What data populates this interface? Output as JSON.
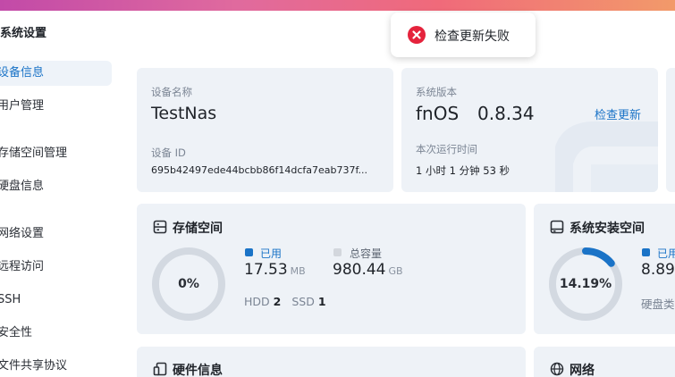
{
  "window": {
    "title": "系统设置"
  },
  "toast": {
    "message": "检查更新失败",
    "accent": "#e5233c"
  },
  "sidebar": {
    "items": [
      {
        "label": "设备信息",
        "active": true
      },
      {
        "label": "用户管理"
      },
      {
        "label": "存储空间管理"
      },
      {
        "label": "硬盘信息"
      },
      {
        "label": "网络设置"
      },
      {
        "label": "远程访问"
      },
      {
        "label": "SSH"
      },
      {
        "label": "安全性"
      },
      {
        "label": "文件共享协议"
      }
    ]
  },
  "device": {
    "name_label": "设备名称",
    "name": "TestNas",
    "id_label": "设备 ID",
    "id": "695b42497ede44bcbb86f14dcfa7eab737f..."
  },
  "system": {
    "version_label": "系统版本",
    "version_name": "fnOS",
    "version_number": "0.8.34",
    "check_update": "检查更新",
    "uptime_label": "本次运行时间",
    "uptime": "1 小时 1 分钟 53 秒"
  },
  "storage": {
    "title": "存储空间",
    "percent_text": "0%",
    "percent": 0,
    "used_label": "已用",
    "used_value": "17.53",
    "used_unit": "MB",
    "total_label": "总容量",
    "total_value": "980.44",
    "total_unit": "GB",
    "hdd_label": "HDD",
    "hdd_count": "2",
    "ssd_label": "SSD",
    "ssd_count": "1",
    "used_color": "#1a73c7",
    "total_color": "#d3d7dd"
  },
  "system_disk": {
    "title": "系统安装空间",
    "percent_text": "14.19%",
    "percent": 14.19,
    "used_label": "已用",
    "used_value": "8.89",
    "type_label": "硬盘类"
  },
  "hardware": {
    "title": "硬件信息"
  },
  "network": {
    "title": "网络"
  }
}
